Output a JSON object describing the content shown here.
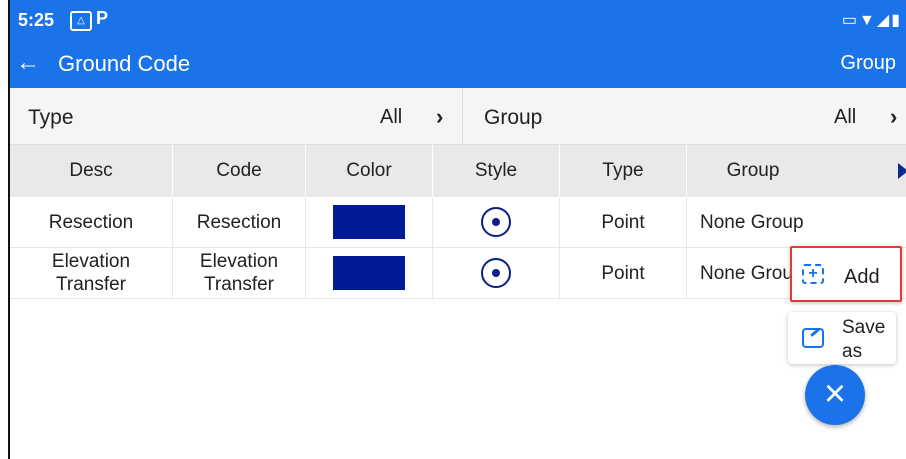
{
  "status_bar": {
    "time": "5:25",
    "icons": [
      "gallery-icon",
      "parking-icon",
      "cast-icon",
      "wifi-icon",
      "signal-icon",
      "battery-icon"
    ]
  },
  "app_bar": {
    "title": "Ground Code",
    "action": "Group"
  },
  "filters": [
    {
      "label": "Type",
      "value": "All"
    },
    {
      "label": "Group",
      "value": "All"
    }
  ],
  "table": {
    "headers": [
      "Desc",
      "Code",
      "Color",
      "Style",
      "Type",
      "Group"
    ],
    "rows": [
      {
        "desc": "Resection",
        "code": "Resection",
        "color": "#001a96",
        "style_icon": "target-icon",
        "type": "Point",
        "group": "None Group"
      },
      {
        "desc": "Elevation\nTransfer",
        "code": "Elevation\nTransfer",
        "color": "#001a96",
        "style_icon": "target-icon",
        "type": "Point",
        "group": "None Grou"
      }
    ]
  },
  "fab_menu": {
    "add_label": "Add",
    "save_as_label": "Save\nas"
  },
  "colors": {
    "primary": "#1a73e8",
    "swatch": "#001a96",
    "highlight": "#e53935"
  }
}
